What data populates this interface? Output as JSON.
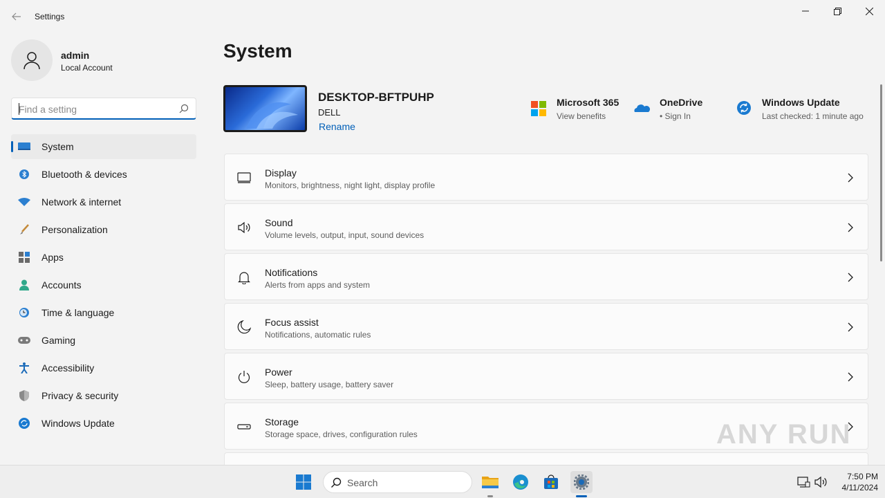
{
  "window": {
    "title": "Settings",
    "controls": {
      "minimize": "minimize-icon",
      "maximize": "restore-icon",
      "close": "close-icon"
    }
  },
  "user": {
    "name": "admin",
    "type": "Local Account"
  },
  "search": {
    "placeholder": "Find a setting"
  },
  "sidebar": {
    "items": [
      {
        "label": "System",
        "icon": "system-icon",
        "active": true
      },
      {
        "label": "Bluetooth & devices",
        "icon": "bluetooth-icon"
      },
      {
        "label": "Network & internet",
        "icon": "wifi-icon"
      },
      {
        "label": "Personalization",
        "icon": "brush-icon"
      },
      {
        "label": "Apps",
        "icon": "apps-icon"
      },
      {
        "label": "Accounts",
        "icon": "accounts-icon"
      },
      {
        "label": "Time & language",
        "icon": "clock-globe-icon"
      },
      {
        "label": "Gaming",
        "icon": "gamepad-icon"
      },
      {
        "label": "Accessibility",
        "icon": "accessibility-icon"
      },
      {
        "label": "Privacy & security",
        "icon": "shield-icon"
      },
      {
        "label": "Windows Update",
        "icon": "update-icon"
      }
    ]
  },
  "main": {
    "title": "System",
    "device": {
      "name": "DESKTOP-BFTPUHP",
      "model": "DELL",
      "rename": "Rename"
    },
    "quick_links": [
      {
        "title": "Microsoft 365",
        "sub": "View benefits",
        "icon": "microsoft-365-icon"
      },
      {
        "title": "OneDrive",
        "sub": "• Sign In",
        "icon": "onedrive-cloud-icon"
      },
      {
        "title": "Windows Update",
        "sub": "Last checked: 1 minute ago",
        "icon": "windows-update-icon"
      }
    ],
    "cards": [
      {
        "title": "Display",
        "sub": "Monitors, brightness, night light, display profile",
        "icon": "display-icon"
      },
      {
        "title": "Sound",
        "sub": "Volume levels, output, input, sound devices",
        "icon": "speaker-icon"
      },
      {
        "title": "Notifications",
        "sub": "Alerts from apps and system",
        "icon": "bell-icon"
      },
      {
        "title": "Focus assist",
        "sub": "Notifications, automatic rules",
        "icon": "moon-icon"
      },
      {
        "title": "Power",
        "sub": "Sleep, battery usage, battery saver",
        "icon": "power-icon"
      },
      {
        "title": "Storage",
        "sub": "Storage space, drives, configuration rules",
        "icon": "storage-drive-icon"
      }
    ]
  },
  "taskbar": {
    "search_label": "Search",
    "apps": [
      "file-explorer-icon",
      "edge-icon",
      "store-icon",
      "settings-gear-icon"
    ],
    "time": "7:50 PM",
    "date": "4/11/2024"
  },
  "watermark": "ANY RUN",
  "colors": {
    "accent": "#005fb8",
    "background": "#f3f3f3",
    "card": "#fbfbfb"
  }
}
